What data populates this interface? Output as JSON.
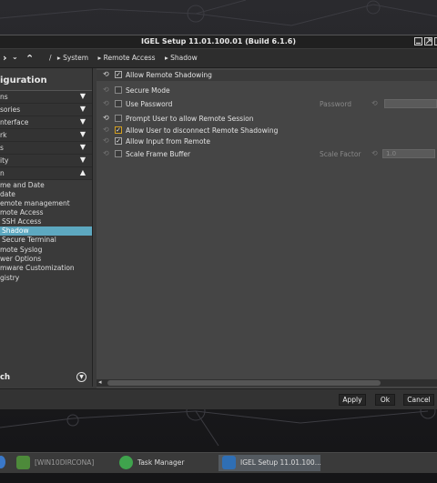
{
  "window": {
    "title": "IGEL Setup 11.01.100.01 (Build 6.1.6)"
  },
  "toolbar": {
    "back_glyph": "›",
    "up_glyph": "⌃",
    "crumb_sep": "/",
    "breadcrumb": [
      "System",
      "Remote Access",
      "Shadow"
    ]
  },
  "sidebar": {
    "title": "iguration",
    "categories": [
      {
        "label": "ns",
        "arrow": "▼"
      },
      {
        "label": "sories",
        "arrow": "▼"
      },
      {
        "label": "nterface",
        "arrow": "▼"
      },
      {
        "label": "rk",
        "arrow": "▼"
      },
      {
        "label": "s",
        "arrow": "▼"
      },
      {
        "label": "ity",
        "arrow": "▼"
      },
      {
        "label": "n",
        "arrow": "▲"
      }
    ],
    "items": [
      "me and Date",
      "date",
      "emote management",
      "mote Access",
      "SSH Access",
      "Shadow",
      "Secure Terminal",
      "mote Syslog",
      "wer Options",
      "mware Customization",
      "gistry"
    ],
    "search_label": "ch",
    "search_icon": "▼"
  },
  "settings": {
    "allow_remote_shadowing": {
      "label": "Allow Remote Shadowing",
      "checked": "✓"
    },
    "secure_mode": {
      "label": "Secure Mode",
      "checked": ""
    },
    "use_password": {
      "label": "Use Password",
      "checked": "",
      "field_label": "Password",
      "field_value": ""
    },
    "prompt_user": {
      "label": "Prompt User to allow Remote Session",
      "checked": ""
    },
    "allow_disconnect": {
      "label": "Allow User to disconnect Remote Shadowing",
      "checked": "✓"
    },
    "allow_input": {
      "label": "Allow Input from Remote",
      "checked": "✓"
    },
    "scale_frame_buffer": {
      "label": "Scale Frame Buffer",
      "checked": "",
      "field_label": "Scale Factor",
      "field_value": "1.0"
    }
  },
  "footer": {
    "apply_label": "Apply",
    "ok_label": "Ok",
    "cancel_label": "Cancel"
  },
  "taskbar": {
    "items": [
      {
        "label": "[WIN10DIRCONA]"
      },
      {
        "label": "Task Manager"
      },
      {
        "label": "IGEL Setup 11.01.100..."
      }
    ]
  },
  "colors": {
    "selection": "#5da8c0",
    "highlight_checkbox": "#d4a020",
    "window_bg": "#3b3b3b",
    "panel_bg": "#454545"
  }
}
